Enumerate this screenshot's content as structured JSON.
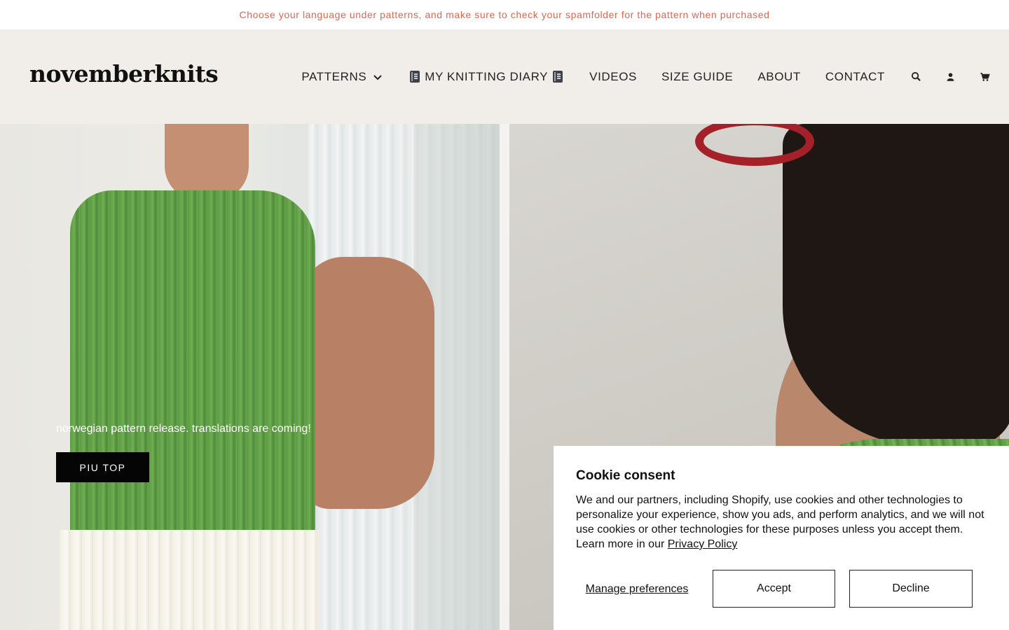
{
  "announcement": {
    "text": "Choose your language under patterns, and make sure to check your spamfolder for the pattern when purchased",
    "color": "#e0654e"
  },
  "header": {
    "logo": "novemberknits",
    "nav": {
      "patterns": "PATTERNS",
      "diary": "MY KNITTING DIARY",
      "videos": "VIDEOS",
      "size_guide": "SIZE GUIDE",
      "about": "ABOUT",
      "contact": "CONTACT"
    },
    "icons": [
      "chevron-down-icon",
      "notebook-icon",
      "search-icon",
      "account-icon",
      "cart-icon"
    ]
  },
  "hero": {
    "caption": "norwegian pattern release. translations are coming!",
    "button": "PIU TOP"
  },
  "cookie": {
    "title": "Cookie consent",
    "body": "We and our partners, including Shopify, use cookies and other technologies to personalize your experience, show you ads, and perform analytics, and we will not use cookies or other technologies for these purposes unless you accept them. Learn more in our ",
    "privacy_link": "Privacy Policy",
    "manage": "Manage preferences",
    "accept": "Accept",
    "decline": "Decline"
  },
  "colors": {
    "header_bg": "#f1eeea",
    "knit_green": "#6aa84f",
    "button_black": "#050505"
  }
}
